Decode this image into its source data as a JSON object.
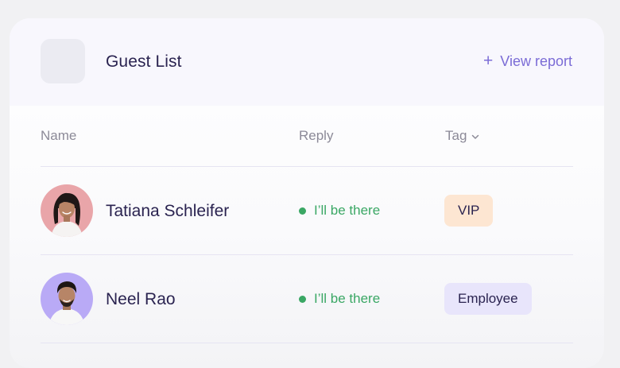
{
  "header": {
    "title": "Guest List",
    "view_report_label": "View report",
    "view_report_icon": "plus-icon"
  },
  "columns": {
    "name": "Name",
    "reply": "Reply",
    "tag": "Tag",
    "tag_icon": "chevron-down-icon"
  },
  "guests": [
    {
      "name": "Tatiana Schleifer",
      "reply": "I’ll be there",
      "tag": "VIP",
      "tag_bg": "#fde6d2",
      "avatar_bg": "#e9a5a9"
    },
    {
      "name": "Neel Rao",
      "reply": "I’ll be there",
      "tag": "Employee",
      "tag_bg": "#e8e5fb",
      "avatar_bg": "#b9aaf6"
    }
  ],
  "colors": {
    "accent": "#7b6cd6",
    "reply_green": "#3aa764",
    "text_dark": "#2a2350",
    "text_muted": "#8c8a98"
  }
}
